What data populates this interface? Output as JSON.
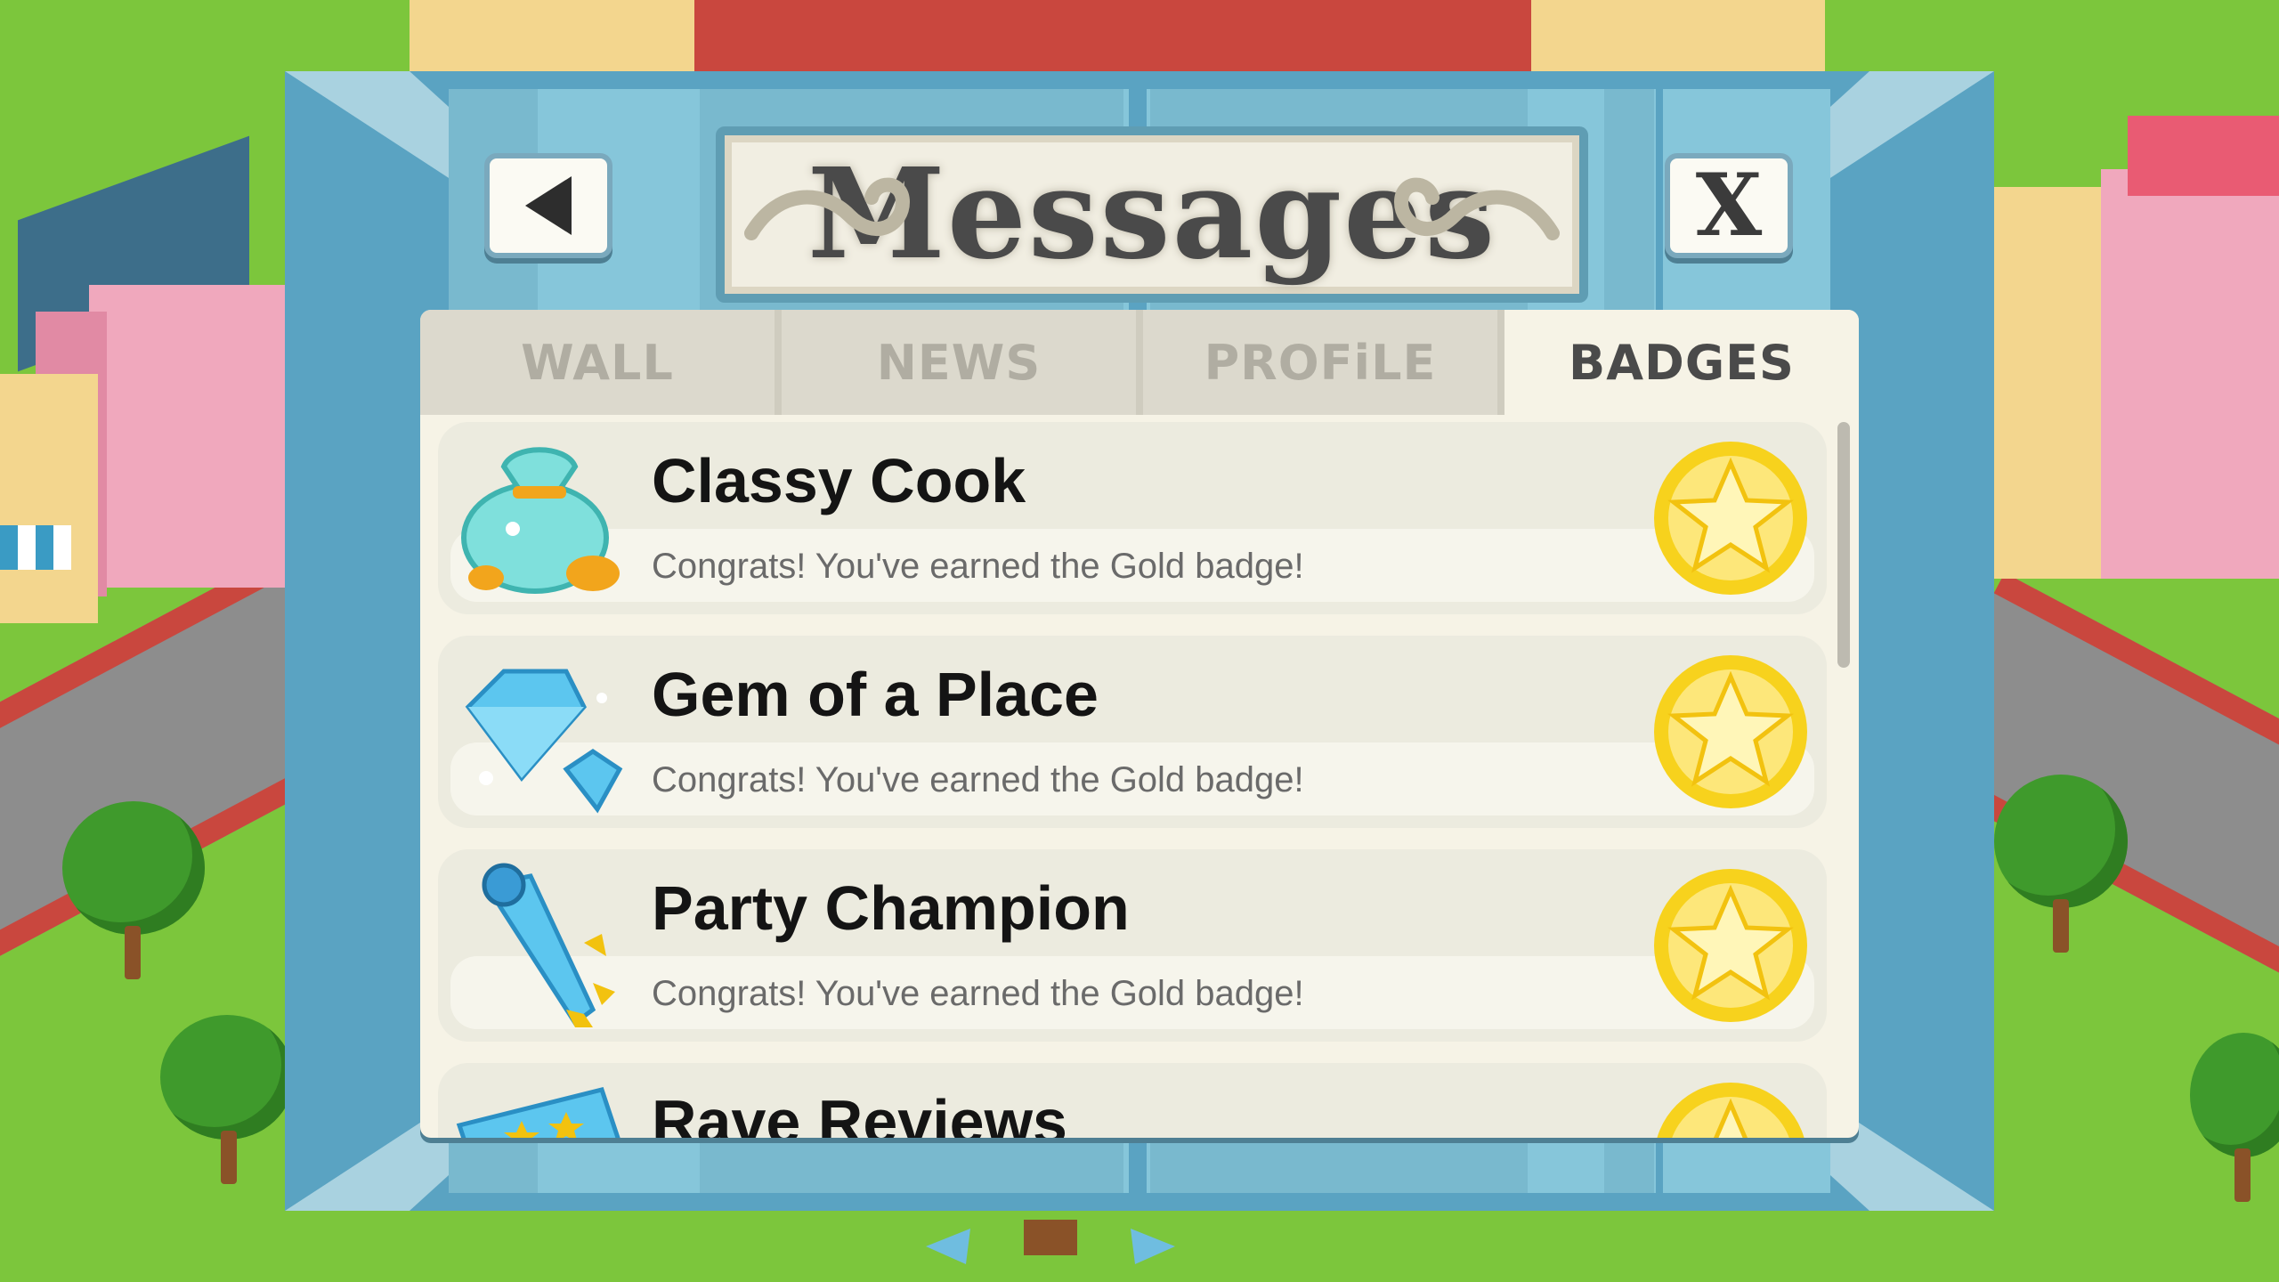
{
  "dialog": {
    "title": "Messages",
    "back_icon": "back-arrow-icon",
    "close_label": "X"
  },
  "tabs": [
    {
      "label": "WALL",
      "active": false
    },
    {
      "label": "NEWS",
      "active": false
    },
    {
      "label": "PROFiLE",
      "active": false
    },
    {
      "label": "BADGES",
      "active": true
    }
  ],
  "badges": [
    {
      "title": "Classy Cook",
      "message": "Congrats! You've earned the Gold badge!",
      "icon": "money-bag-icon",
      "badge_icon": "gold-star-badge-icon"
    },
    {
      "title": "Gem of a Place",
      "message": "Congrats! You've earned the Gold badge!",
      "icon": "diamond-gems-icon",
      "badge_icon": "gold-star-badge-icon"
    },
    {
      "title": "Party Champion",
      "message": "Congrats! You've earned the Gold badge!",
      "icon": "party-horn-icon",
      "badge_icon": "gold-star-badge-icon"
    },
    {
      "title": "Rave Reviews",
      "message": "",
      "icon": "review-ticket-icon",
      "badge_icon": "gold-star-badge-icon"
    }
  ],
  "colors": {
    "frame": "#5aa3c2",
    "panel": "#f6f3e6",
    "gold": "#f5c518",
    "grass": "#7cc63c"
  }
}
